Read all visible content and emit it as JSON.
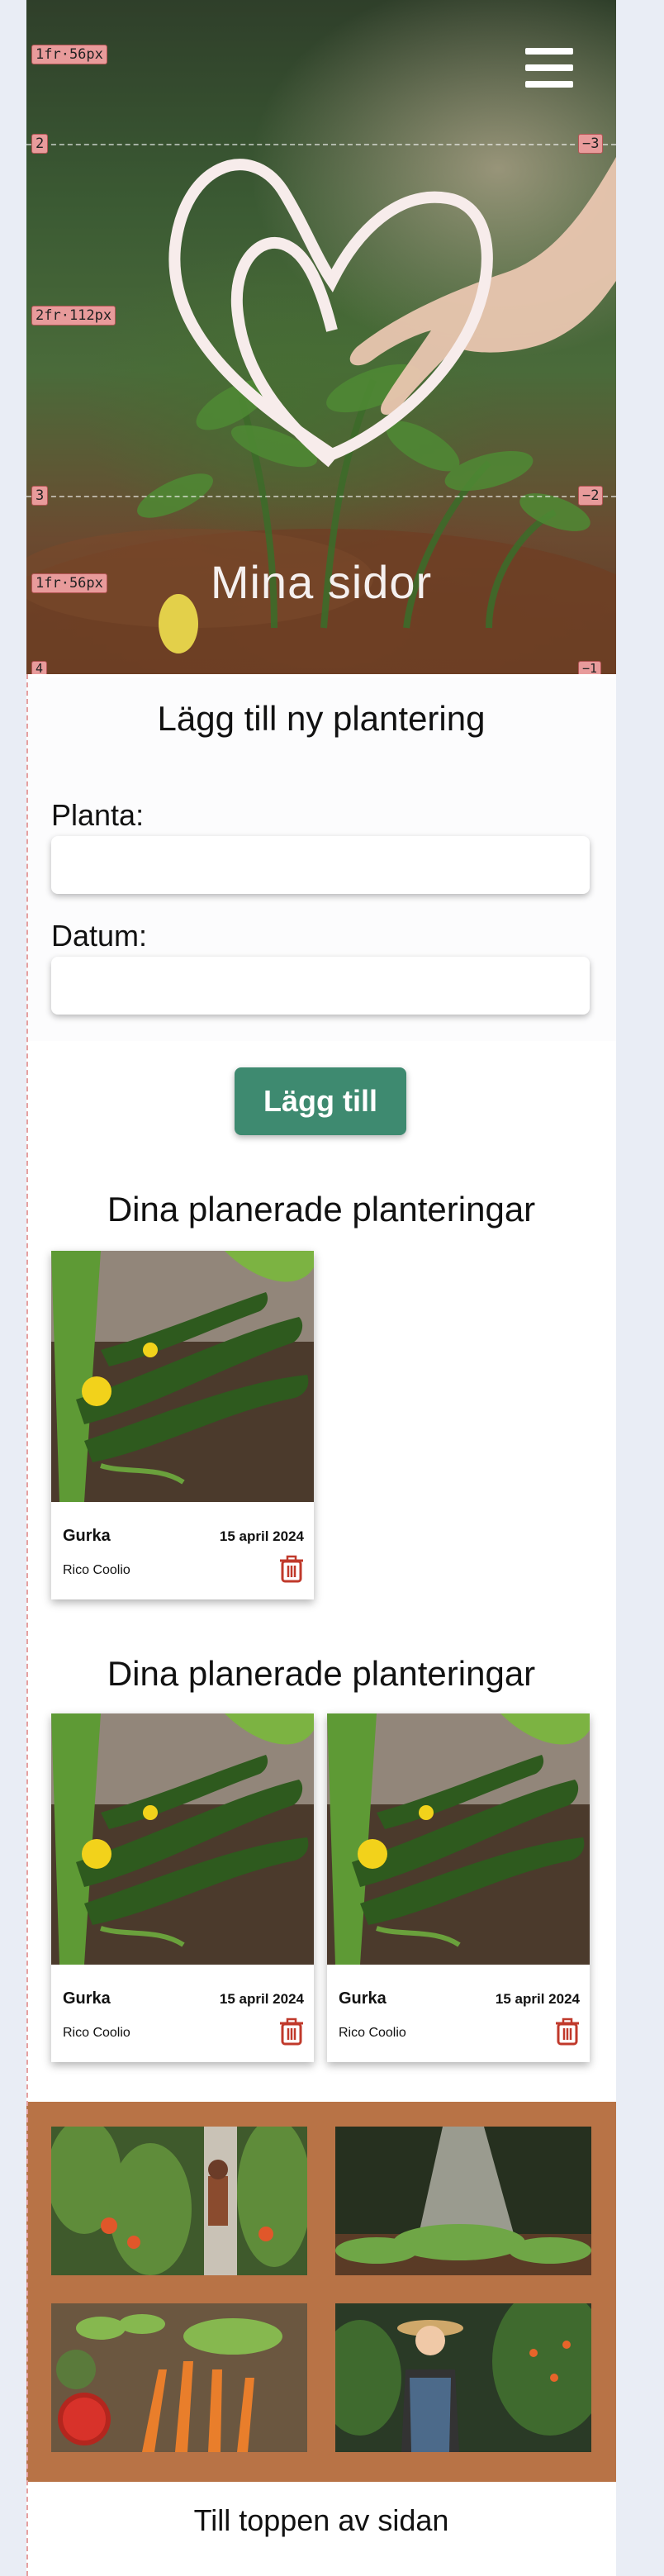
{
  "hero": {
    "title": "Mina sidor",
    "grid_tags": {
      "row1": "1fr·56px",
      "row2": "2fr·112px",
      "row3": "1fr·56px",
      "l2": "2",
      "l3": "3",
      "l4": "4",
      "lneg2": "−2",
      "rneg3": "−3",
      "rneg2": "−2",
      "rneg1": "−1",
      "rneg1b": "−1"
    }
  },
  "form": {
    "title": "Lägg till ny plantering",
    "plant_label": "Planta:",
    "plant_value": "",
    "date_label": "Datum:",
    "date_value": "",
    "submit_label": "Lägg till"
  },
  "planned_section_1": {
    "title": "Dina planerade planteringar",
    "cards": [
      {
        "name": "Gurka",
        "date": "15 april 2024",
        "owner": "Rico Coolio"
      }
    ]
  },
  "planned_section_2": {
    "title": "Dina planerade planteringar",
    "cards": [
      {
        "name": "Gurka",
        "date": "15 april 2024",
        "owner": "Rico Coolio"
      },
      {
        "name": "Gurka",
        "date": "15 april 2024",
        "owner": "Rico Coolio"
      }
    ]
  },
  "gallery": {
    "images": [
      "greenhouse-worker",
      "watering-seedlings",
      "vegetable-harvest",
      "farmer-woman"
    ]
  },
  "footer": {
    "back_to_top": "Till toppen av sidan"
  },
  "colors": {
    "accent_green": "#3e8a70",
    "gallery_bg": "#b87346",
    "trash_red": "#c0392b"
  }
}
